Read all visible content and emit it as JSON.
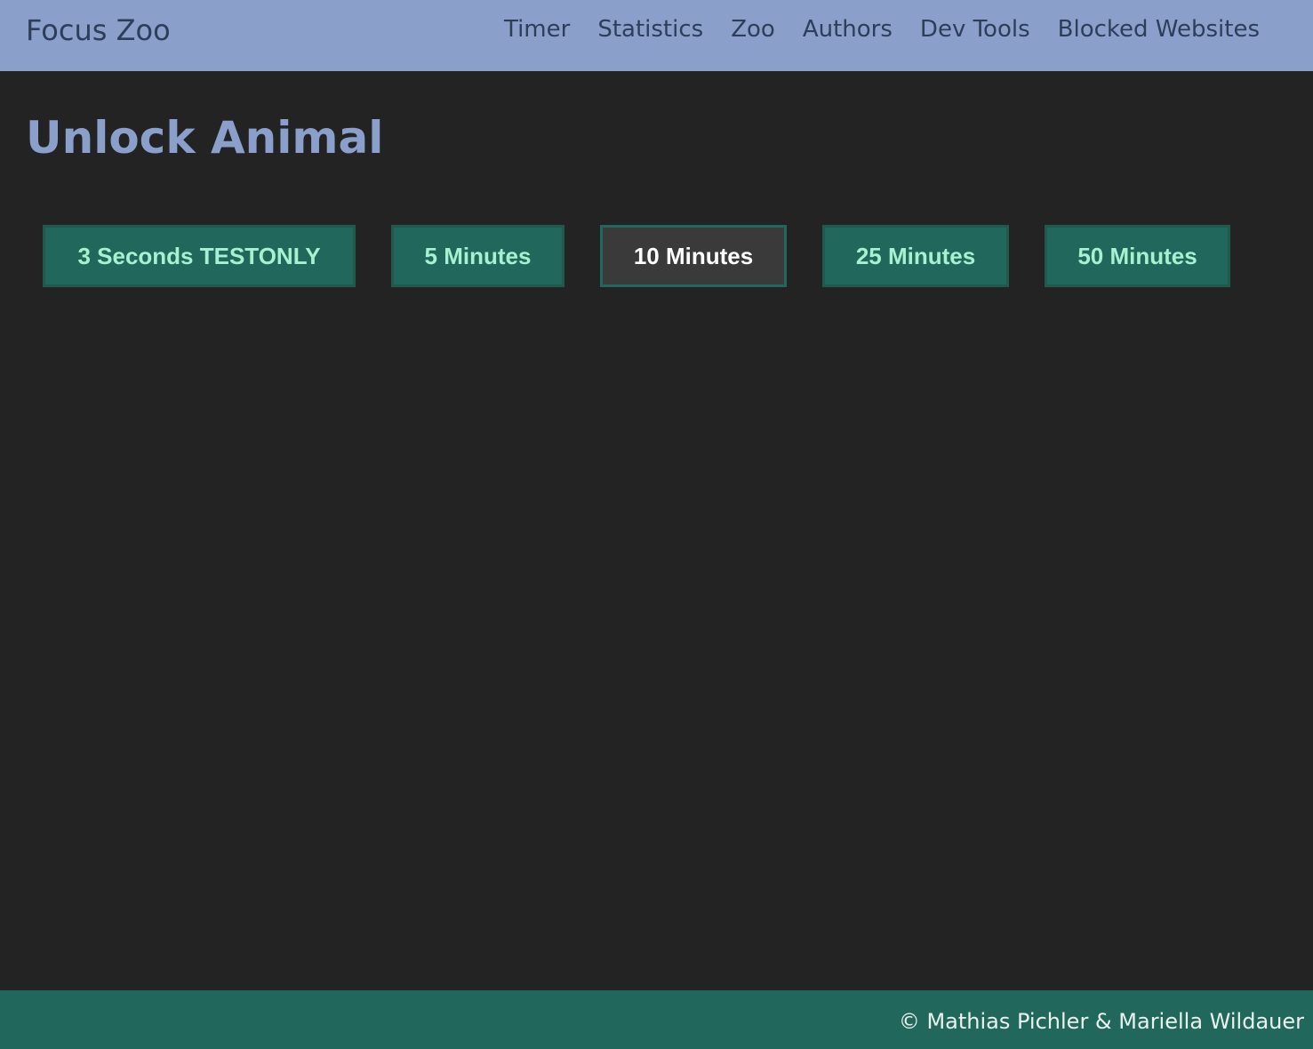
{
  "navbar": {
    "brand": "Focus Zoo",
    "links": [
      "Timer",
      "Statistics",
      "Zoo",
      "Authors",
      "Dev Tools",
      "Blocked Websites"
    ],
    "background_color": "#8aa0cb"
  },
  "main": {
    "title": "Unlock Animal",
    "durations": [
      {
        "label": "3 Seconds TESTONLY",
        "selected": false
      },
      {
        "label": "5 Minutes",
        "selected": false
      },
      {
        "label": "10 Minutes",
        "selected": true
      },
      {
        "label": "25 Minutes",
        "selected": false
      },
      {
        "label": "50 Minutes",
        "selected": false
      }
    ],
    "button_color": "#22675c",
    "button_text_color": "#a8f0d0",
    "selected_button_color": "#3a3a3a"
  },
  "footer": {
    "copyright": "© Mathias Pichler & Mariella Wildauer",
    "background_color": "#22675c"
  }
}
